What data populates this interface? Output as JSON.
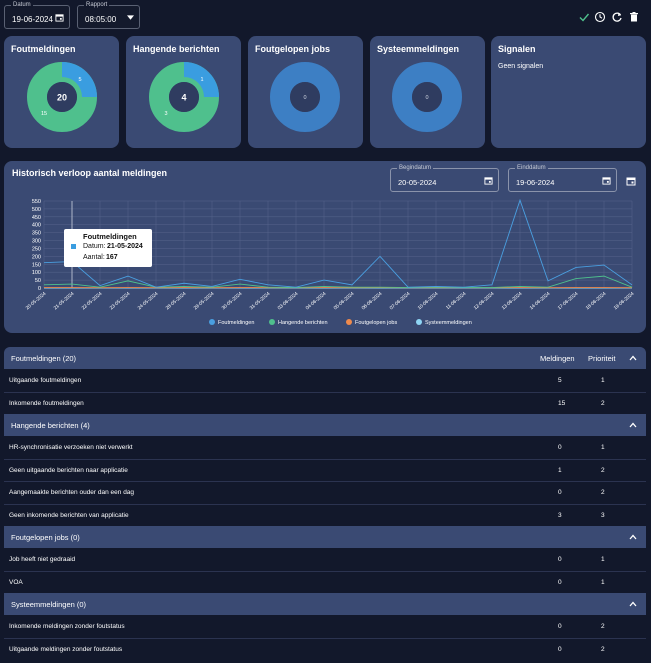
{
  "toolbar": {
    "datum_label": "Datum",
    "datum_value": "19-06-2024",
    "rapport_label": "Rapport",
    "rapport_value": "08:05:00",
    "icons": [
      "check-icon",
      "clock-icon",
      "refresh-icon",
      "trash-icon"
    ]
  },
  "cards": {
    "foutmeldingen": {
      "title": "Foutmeldingen",
      "total": "20",
      "seg_blue": "5",
      "seg_green": "15"
    },
    "hangende": {
      "title": "Hangende berichten",
      "total": "4",
      "seg_blue": "1",
      "seg_green": "3"
    },
    "jobs": {
      "title": "Foutgelopen jobs",
      "total": "0"
    },
    "systeem": {
      "title": "Systeemmeldingen",
      "total": "0"
    },
    "signalen": {
      "title": "Signalen",
      "text": "Geen signalen"
    }
  },
  "history": {
    "title": "Historisch verloop aantal meldingen",
    "begin_label": "Begindatum",
    "begin_value": "20-05-2024",
    "eind_label": "Einddatum",
    "eind_value": "19-06-2024",
    "tooltip": {
      "title": "Foutmeldingen",
      "date_label": "Datum:",
      "date_value": "21-05-2024",
      "count_label": "Aantal:",
      "count_value": "167"
    }
  },
  "chart_data": {
    "type": "line",
    "x": [
      "20-05-2024",
      "21-05-2024",
      "22-05-2024",
      "23-05-2024",
      "24-05-2024",
      "28-05-2024",
      "29-05-2024",
      "30-05-2024",
      "31-05-2024",
      "03-06-2024",
      "04-06-2024",
      "05-06-2024",
      "06-06-2024",
      "07-06-2024",
      "10-06-2024",
      "11-06-2024",
      "12-06-2024",
      "13-06-2024",
      "14-06-2024",
      "17-06-2024",
      "18-06-2024",
      "19-06-2024"
    ],
    "yticks": [
      "550",
      "500",
      "450",
      "400",
      "350",
      "300",
      "250",
      "200",
      "150",
      "100",
      "50",
      "0"
    ],
    "ylim": [
      0,
      550
    ],
    "series": [
      {
        "name": "Foutmeldingen",
        "color": "#4a9fe0",
        "values": [
          160,
          167,
          15,
          75,
          5,
          30,
          10,
          55,
          20,
          5,
          50,
          20,
          200,
          5,
          10,
          5,
          20,
          555,
          45,
          130,
          145,
          20
        ]
      },
      {
        "name": "Hangende berichten",
        "color": "#4fc08d",
        "values": [
          20,
          25,
          5,
          45,
          5,
          10,
          5,
          25,
          5,
          3,
          10,
          5,
          5,
          3,
          5,
          3,
          3,
          10,
          5,
          60,
          75,
          5
        ]
      },
      {
        "name": "Foutgelopen jobs",
        "color": "#ef8a4c",
        "values": [
          3,
          3,
          2,
          3,
          2,
          3,
          2,
          3,
          2,
          2,
          3,
          2,
          3,
          2,
          2,
          2,
          2,
          3,
          2,
          3,
          3,
          2
        ]
      },
      {
        "name": "Systeemmeldingen",
        "color": "#8fd6f5",
        "values": [
          0,
          0,
          0,
          0,
          0,
          0,
          0,
          0,
          0,
          0,
          0,
          0,
          0,
          0,
          0,
          0,
          0,
          0,
          0,
          0,
          0,
          0
        ]
      }
    ]
  },
  "table": {
    "col_meldingen": "Meldingen",
    "col_prioriteit": "Prioriteit",
    "sections": [
      {
        "title": "Foutmeldingen (20)",
        "rows": [
          {
            "name": "Uitgaande foutmeldingen",
            "meldingen": "5",
            "prioriteit": "1"
          },
          {
            "name": "Inkomende foutmeldingen",
            "meldingen": "15",
            "prioriteit": "2"
          }
        ]
      },
      {
        "title": "Hangende berichten (4)",
        "rows": [
          {
            "name": "HR-synchronisatie verzoeken niet verwerkt",
            "meldingen": "0",
            "prioriteit": "1"
          },
          {
            "name": "Geen uitgaande berichten naar applicatie",
            "meldingen": "1",
            "prioriteit": "2"
          },
          {
            "name": "Aangemaakte berichten ouder dan een dag",
            "meldingen": "0",
            "prioriteit": "2"
          },
          {
            "name": "Geen inkomende berichten van applicatie",
            "meldingen": "3",
            "prioriteit": "3"
          }
        ]
      },
      {
        "title": "Foutgelopen jobs (0)",
        "rows": [
          {
            "name": "Job heeft niet gedraaid",
            "meldingen": "0",
            "prioriteit": "1"
          },
          {
            "name": "VOA",
            "meldingen": "0",
            "prioriteit": "1"
          }
        ]
      },
      {
        "title": "Systeemmeldingen (0)",
        "rows": [
          {
            "name": "Inkomende meldingen zonder foutstatus",
            "meldingen": "0",
            "prioriteit": "2"
          },
          {
            "name": "Uitgaande meldingen zonder foutstatus",
            "meldingen": "0",
            "prioriteit": "2"
          }
        ]
      }
    ]
  }
}
